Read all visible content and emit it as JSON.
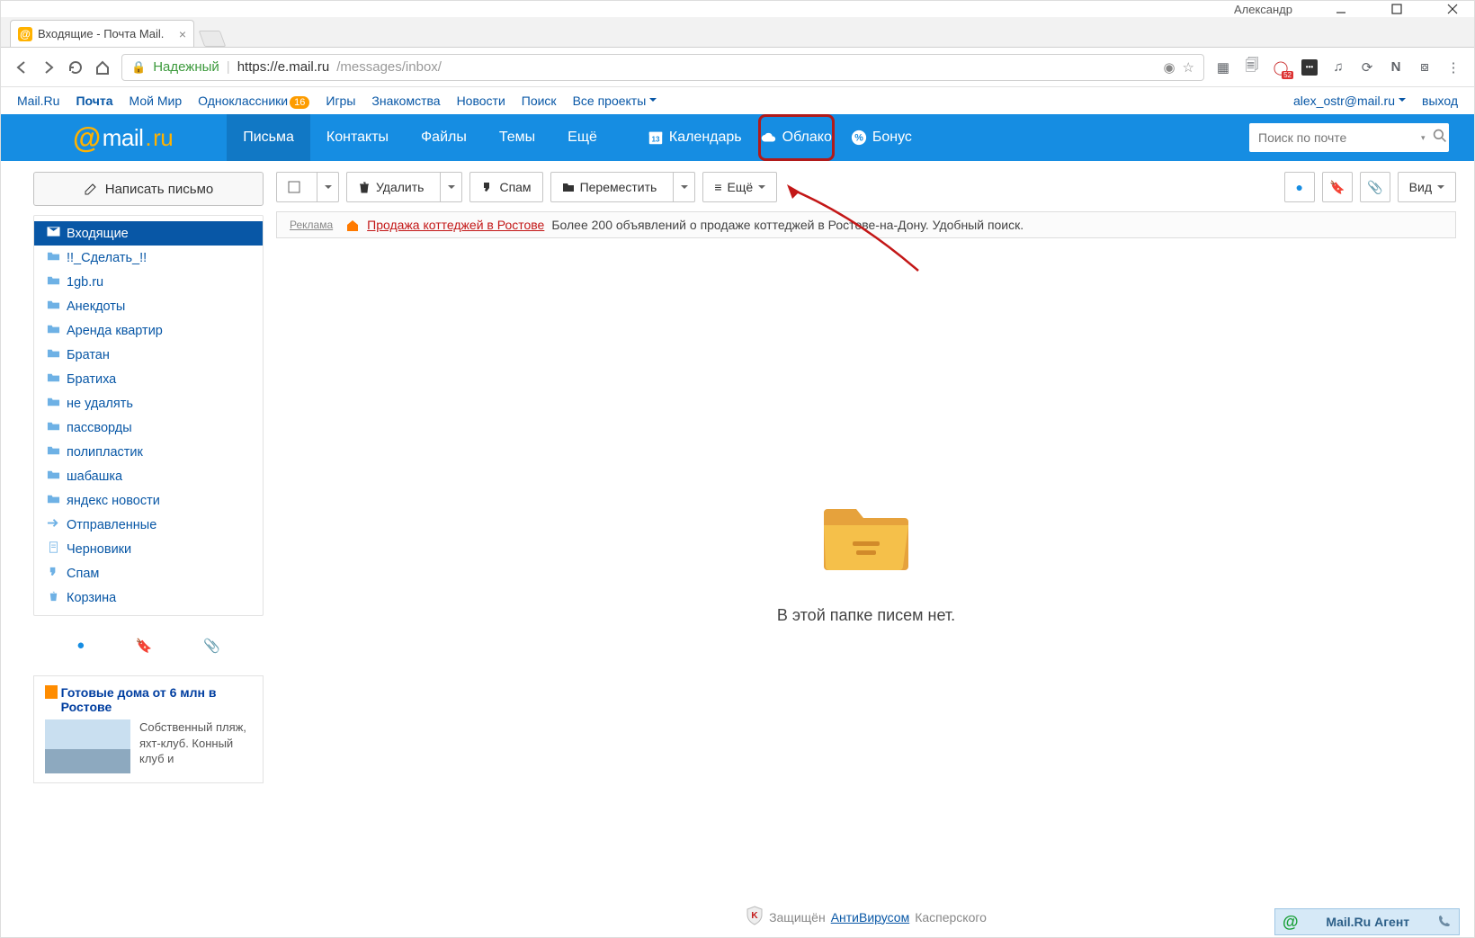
{
  "os": {
    "user": "Александр"
  },
  "browser": {
    "tab_title": "Входящие - Почта Mail.",
    "secure_label": "Надежный",
    "url_host": "https://e.mail.ru",
    "url_path": "/messages/inbox/",
    "ext_badge": "52"
  },
  "portal": {
    "links": [
      "Mail.Ru",
      "Почта",
      "Мой Мир",
      "Одноклассники",
      "Игры",
      "Знакомства",
      "Новости",
      "Поиск",
      "Все проекты"
    ],
    "ok_badge": "16",
    "email": "alex_ostr@mail.ru",
    "logout": "выход"
  },
  "mainnav": {
    "items": [
      "Письма",
      "Контакты",
      "Файлы",
      "Темы",
      "Ещё"
    ],
    "calendar": "Календарь",
    "calendar_day": "13",
    "cloud": "Облако",
    "bonus": "Бонус",
    "search_placeholder": "Поиск по почте"
  },
  "left": {
    "compose": "Написать письмо",
    "folders": [
      {
        "name": "Входящие",
        "type": "inbox",
        "sel": true
      },
      {
        "name": "!!_Сделать_!!",
        "type": "folder"
      },
      {
        "name": "1gb.ru",
        "type": "folder"
      },
      {
        "name": "Анекдоты",
        "type": "folder"
      },
      {
        "name": "Аренда квартир",
        "type": "folder"
      },
      {
        "name": "Братан",
        "type": "folder"
      },
      {
        "name": "Братиха",
        "type": "folder"
      },
      {
        "name": "не удалять",
        "type": "folder"
      },
      {
        "name": "пассворды",
        "type": "folder"
      },
      {
        "name": "полипластик",
        "type": "folder"
      },
      {
        "name": "шабашка",
        "type": "folder"
      },
      {
        "name": "яндекс новости",
        "type": "folder"
      },
      {
        "name": "Отправленные",
        "type": "sent"
      },
      {
        "name": "Черновики",
        "type": "drafts"
      },
      {
        "name": "Спам",
        "type": "spam"
      },
      {
        "name": "Корзина",
        "type": "trash"
      }
    ],
    "ad": {
      "title": "Готовые дома от 6 млн в Ростове",
      "body": "Собственный пляж, яхт-клуб. Конный клуб и"
    }
  },
  "toolbar": {
    "delete": "Удалить",
    "spam": "Спам",
    "move": "Переместить",
    "more": "Ещё",
    "view": "Вид"
  },
  "adstrip": {
    "label": "Реклама",
    "link": "Продажа коттеджей в Ростове",
    "text": "Более 200 объявлений о продаже коттеджей в Ростове-на-Дону. Удобный поиск."
  },
  "empty_msg": "В этой папке писем нет.",
  "av": {
    "pre": "Защищён",
    "link": "АнтиВирусом",
    "post": "Касперского"
  },
  "agent": "Mail.Ru Агент"
}
